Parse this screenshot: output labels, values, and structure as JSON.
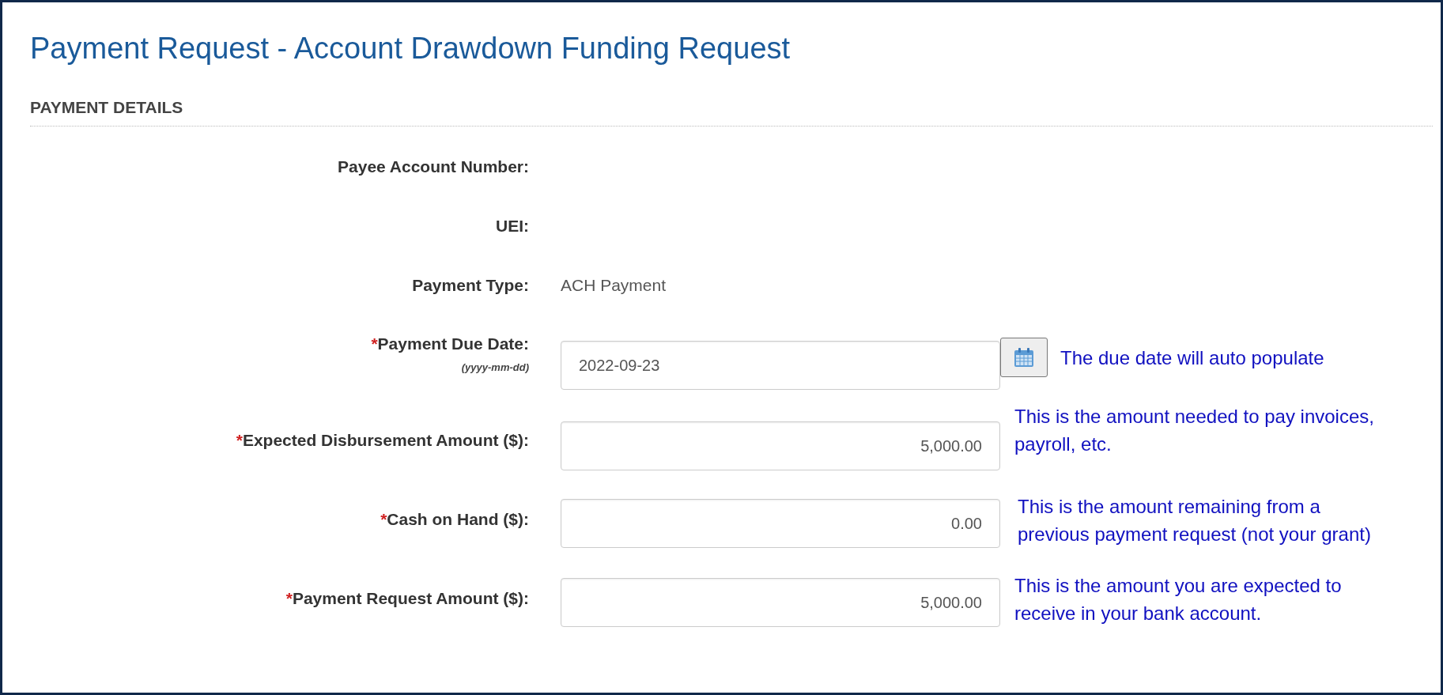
{
  "title": "Payment Request - Account Drawdown Funding Request",
  "section": {
    "heading": "PAYMENT DETAILS"
  },
  "rows": [
    {
      "kind": "static",
      "label": "Payee Account Number:"
    },
    {
      "kind": "static",
      "label": "UEI:"
    },
    {
      "kind": "static",
      "label": "Payment Type:",
      "value": "ACH Payment"
    },
    {
      "kind": "date",
      "marker": "*",
      "label": "Payment Due Date:",
      "hint": "(yyyy-mm-dd)",
      "value": "2022-09-23",
      "note": "The due date will auto populate"
    },
    {
      "kind": "amount",
      "marker": "*",
      "label": "Expected Disbursement Amount ($):",
      "value": "5,000.00",
      "note": "This is the amount needed to pay invoices, payroll, etc."
    },
    {
      "kind": "amount",
      "marker": "*",
      "label": "Cash on Hand ($):",
      "value": "0.00",
      "note": "This is the amount remaining from a previous payment request (not your grant)"
    },
    {
      "kind": "amount",
      "marker": "*",
      "label": "Payment Request Amount ($):",
      "value": "5,000.00",
      "note": "This is the amount you are expected to receive in your bank account."
    }
  ]
}
